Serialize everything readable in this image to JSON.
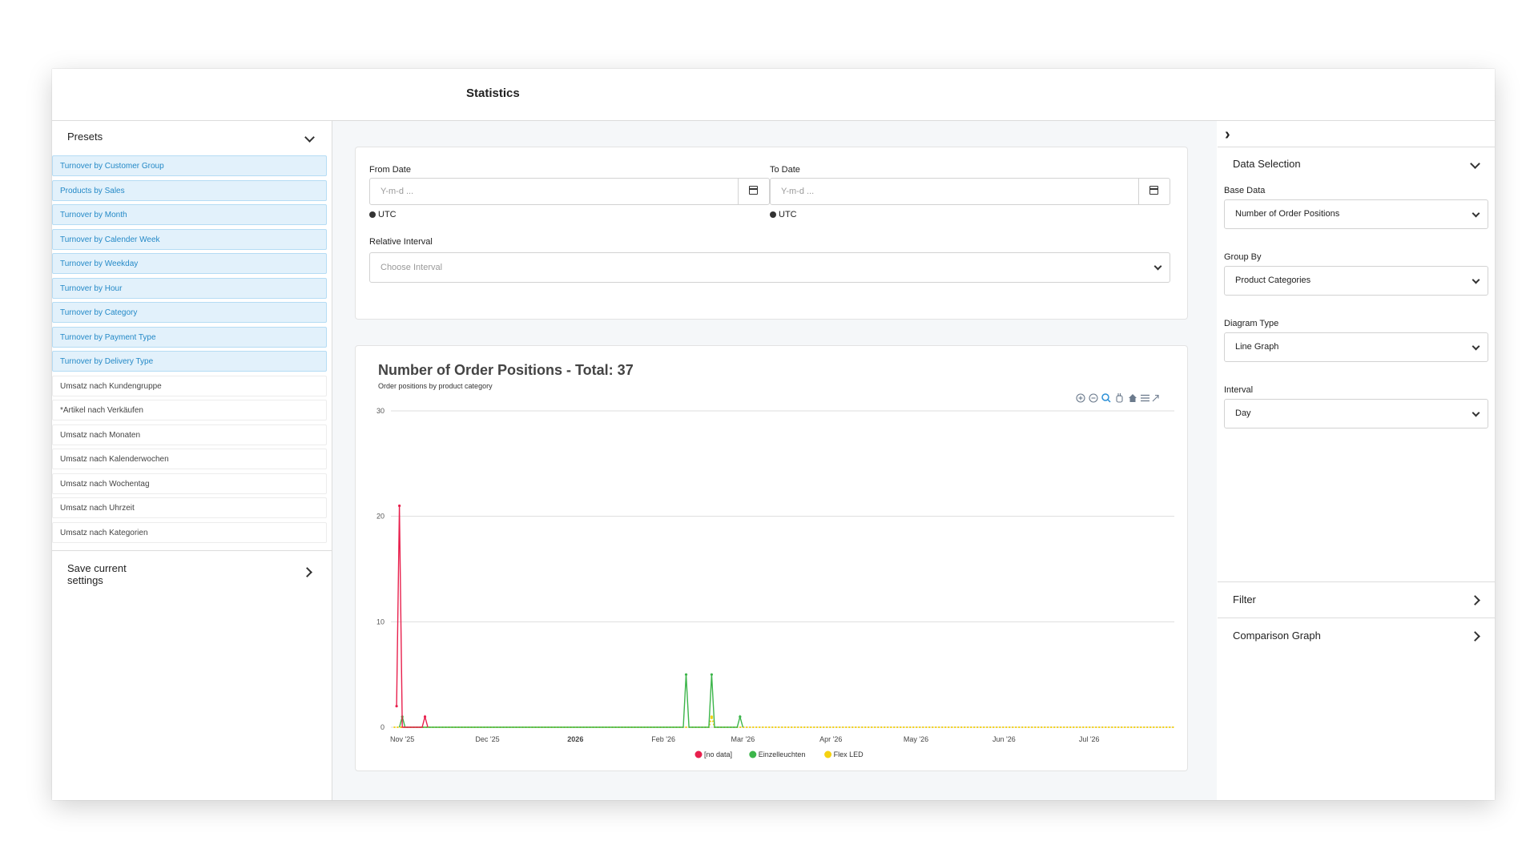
{
  "header": {
    "title": "Statistics"
  },
  "sidebar": {
    "presets_title": "Presets",
    "presets": [
      {
        "label": "Turnover by Customer Group",
        "kind": "en"
      },
      {
        "label": "Products by Sales",
        "kind": "en"
      },
      {
        "label": "Turnover by Month",
        "kind": "en"
      },
      {
        "label": "Turnover by Calender Week",
        "kind": "en"
      },
      {
        "label": "Turnover by Weekday",
        "kind": "en"
      },
      {
        "label": "Turnover by Hour",
        "kind": "en"
      },
      {
        "label": "Turnover by Category",
        "kind": "en"
      },
      {
        "label": "Turnover by Payment Type",
        "kind": "en"
      },
      {
        "label": "Turnover by Delivery Type",
        "kind": "en"
      },
      {
        "label": "Umsatz nach Kundengruppe",
        "kind": "de"
      },
      {
        "label": "*Artikel nach Verkäufen",
        "kind": "de"
      },
      {
        "label": "Umsatz nach Monaten",
        "kind": "de"
      },
      {
        "label": "Umsatz nach Kalenderwochen",
        "kind": "de"
      },
      {
        "label": "Umsatz nach Wochentag",
        "kind": "de"
      },
      {
        "label": "Umsatz nach Uhrzeit",
        "kind": "de"
      },
      {
        "label": "Umsatz nach Kategorien",
        "kind": "de"
      }
    ],
    "save_label": "Save current settings"
  },
  "filters": {
    "from_label": "From Date",
    "from_placeholder": "Y-m-d ...",
    "to_label": "To Date",
    "to_placeholder": "Y-m-d ...",
    "timezone": "UTC",
    "relative_label": "Relative Interval",
    "relative_placeholder": "Choose Interval"
  },
  "chart": {
    "title": "Number of Order Positions - Total: 37",
    "subtitle": "Order positions by product category"
  },
  "chart_data": {
    "type": "line",
    "title": "Number of Order Positions - Total: 37",
    "subtitle": "Order positions by product category",
    "x_type": "date",
    "x_ticks": [
      "Nov '25",
      "Dec '25",
      "2026",
      "Feb '26",
      "Mar '26",
      "Apr '26",
      "May '26",
      "Jun '26",
      "Jul '26"
    ],
    "y_ticks": [
      0,
      10,
      20,
      30
    ],
    "ylim": [
      0,
      30
    ],
    "xlim": [
      "2025-10-28",
      "2026-07-31"
    ],
    "grid": true,
    "legend_position": "bottom",
    "series": [
      {
        "name": "[no data]",
        "color": "#e8204d",
        "points": [
          [
            "2025-10-30",
            2
          ],
          [
            "2025-10-31",
            21
          ],
          [
            "2025-11-01",
            0
          ],
          [
            "2025-11-08",
            0
          ],
          [
            "2025-11-09",
            1
          ],
          [
            "2025-11-10",
            0
          ]
        ]
      },
      {
        "name": "Einzelleuchten",
        "color": "#3cb54a",
        "points": [
          [
            "2025-10-31",
            0
          ],
          [
            "2025-11-01",
            1
          ],
          [
            "2025-11-02",
            0
          ],
          [
            "2026-02-08",
            0
          ],
          [
            "2026-02-09",
            5
          ],
          [
            "2026-02-10",
            0
          ],
          [
            "2026-02-17",
            0
          ],
          [
            "2026-02-18",
            5
          ],
          [
            "2026-02-19",
            0
          ],
          [
            "2026-02-27",
            0
          ],
          [
            "2026-02-28",
            1
          ],
          [
            "2026-03-01",
            0
          ]
        ]
      },
      {
        "name": "Flex LED",
        "color": "#f5d211",
        "points": [
          [
            "2025-10-29",
            0
          ],
          [
            "2026-02-17",
            0
          ],
          [
            "2026-02-18",
            1
          ],
          [
            "2026-02-19",
            0
          ],
          [
            "2026-07-31",
            0
          ]
        ]
      }
    ]
  },
  "right_panel": {
    "data_selection_title": "Data Selection",
    "base_data_label": "Base Data",
    "base_data_value": "Number of Order Positions",
    "group_by_label": "Group By",
    "group_by_value": "Product Categories",
    "diagram_type_label": "Diagram Type",
    "diagram_type_value": "Line Graph",
    "interval_label": "Interval",
    "interval_value": "Day",
    "filter_title": "Filter",
    "comparison_title": "Comparison Graph"
  }
}
